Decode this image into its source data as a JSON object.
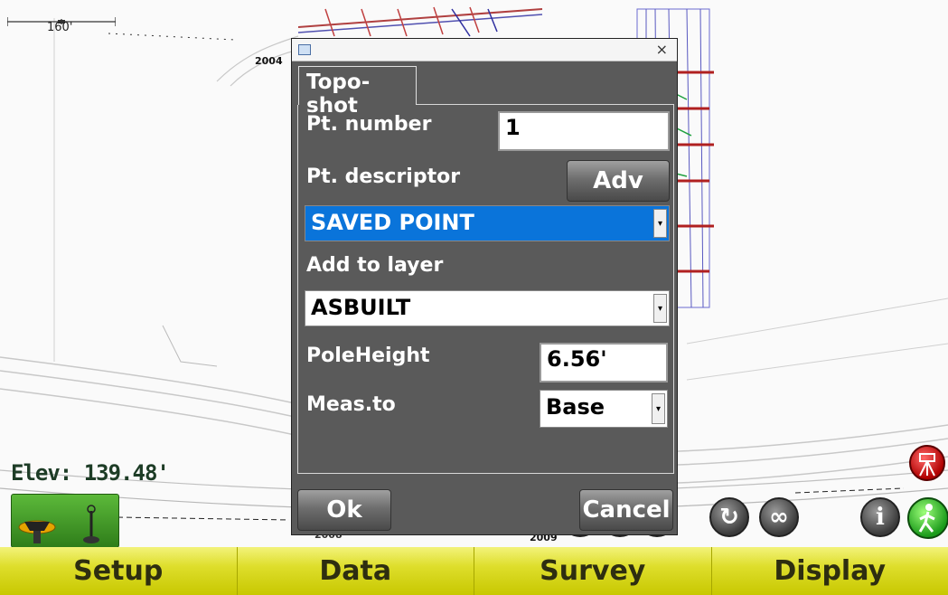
{
  "map": {
    "scale_label": "160'",
    "labels": [
      "2004",
      "2008",
      "2009"
    ],
    "elevation": "Elev: 139.48'"
  },
  "dialog": {
    "close_glyph": "×",
    "tab_label": "Topo-shot",
    "pt_number_label": "Pt. number",
    "pt_number_value": "1",
    "pt_descriptor_label": "Pt. descriptor",
    "adv_label": "Adv",
    "descriptor_value": "SAVED POINT",
    "add_layer_label": "Add to layer",
    "layer_value": "ASBUILT",
    "pole_height_label": "PoleHeight",
    "pole_height_value": "6.56'",
    "meas_to_label": "Meas.to",
    "meas_to_value": "Base",
    "ok_label": "Ok",
    "cancel_label": "Cancel"
  },
  "toolbar": {
    "info_glyph": "i"
  },
  "bottom_bar": [
    "Setup",
    "Data",
    "Survey",
    "Display"
  ],
  "colors": {
    "accent_yellow": "#dede2c",
    "selection_blue": "#0a74da",
    "dialog_gray": "#5a5a5a"
  }
}
